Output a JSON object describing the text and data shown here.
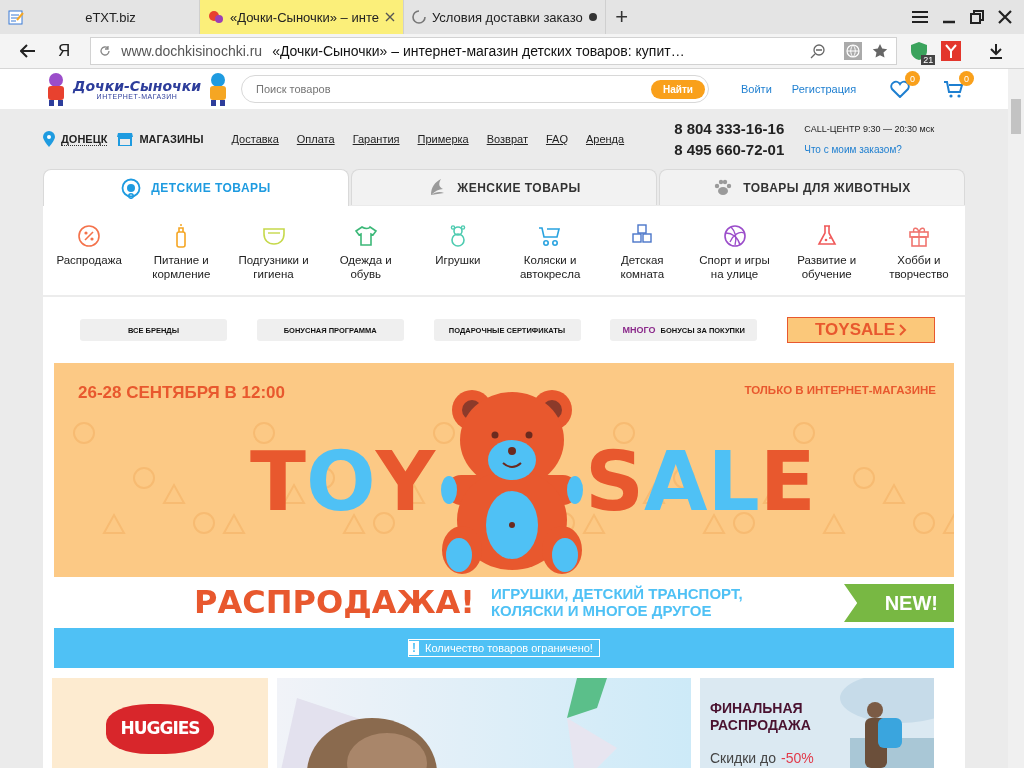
{
  "browser": {
    "tabs": [
      {
        "title": "eTXT.biz",
        "selected": false,
        "kind": "plain"
      },
      {
        "title": "«Дочки-Сыночки» – инте",
        "selected": true,
        "kind": "site"
      },
      {
        "title": "Условия доставки заказо",
        "selected": false,
        "kind": "loading"
      }
    ],
    "new_tab": "+",
    "search_engine": "Я",
    "domain": "www.dochkisinochki.ru",
    "page_title": "«Дочки-Сыночки» – интернет-магазин детских товаров: купит…",
    "protect_count": "21"
  },
  "header": {
    "logo": {
      "name": "Дочки-Сыночки",
      "tagline": "ИНТЕРНЕТ-МАГАЗИН"
    },
    "search": {
      "placeholder": "Поиск товаров",
      "button": "Найти"
    },
    "login": "Войти",
    "register": "Регистрация",
    "favorites_count": "0",
    "cart_count": "0"
  },
  "nav": {
    "city": "ДОНЕЦК",
    "stores": "МАГАЗИНЫ",
    "links": [
      "Доставка",
      "Оплата",
      "Гарантия",
      "Примерка",
      "Возврат",
      "FAQ",
      "Аренда"
    ],
    "phones": [
      "8 804 333-16-16",
      "8 495 660-72-01"
    ],
    "call_center": "CALL-ЦЕНТР 9:30 — 20:30 мск",
    "order_status": "Что с моим заказом?"
  },
  "category_tabs": [
    {
      "label": "ДЕТСКИЕ ТОВАРЫ",
      "selected": true
    },
    {
      "label": "ЖЕНСКИЕ ТОВАРЫ",
      "selected": false
    },
    {
      "label": "ТОВАРЫ ДЛЯ ЖИВОТНЫХ",
      "selected": false
    }
  ],
  "categories": [
    {
      "label": "Распродажа"
    },
    {
      "label": "Питание и кормление"
    },
    {
      "label": "Подгузники и гигиена"
    },
    {
      "label": "Одежда и обувь"
    },
    {
      "label": "Игрушки"
    },
    {
      "label": "Коляски и автокресла"
    },
    {
      "label": "Детская комната"
    },
    {
      "label": "Спорт и игры на улице"
    },
    {
      "label": "Развитие и обучение"
    },
    {
      "label": "Хобби и творчество"
    }
  ],
  "promo_links": [
    {
      "kind": "plain",
      "label": "ВСЕ БРЕНДЫ"
    },
    {
      "kind": "plain",
      "label": "БОНУСНАЯ ПРОГРАММА"
    },
    {
      "kind": "plain",
      "label": "ПОДАРОЧНЫЕ СЕРТИФИКАТЫ"
    },
    {
      "kind": "partner",
      "label": "БОНУСЫ ЗА ПОКУПКИ",
      "logo": "МНОГО"
    },
    {
      "kind": "banner",
      "label": "TOYSALE"
    }
  ],
  "banner": {
    "date": "26-28 СЕНТЯБРЯ В 12:00",
    "only_online": "ТОЛЬКО В ИНТЕРНЕТ-МАГАЗИНЕ",
    "letters": [
      {
        "letter": "T",
        "color": "#e8582e"
      },
      {
        "letter": "O",
        "color": "#4fc1f5"
      },
      {
        "letter": "Y",
        "color": "#e8582e"
      },
      {
        "letter": "S",
        "color": "#e8582e"
      },
      {
        "letter": "A",
        "color": "#4fc1f5"
      },
      {
        "letter": "L",
        "color": "#4fc1f5"
      },
      {
        "letter": "E",
        "color": "#e8582e"
      }
    ],
    "sale_title": "РАСПРОДАЖА!",
    "sale_lines": [
      "ИГРУШКИ, ДЕТСКИЙ ТРАНСПОРТ,",
      "КОЛЯСКИ И МНОГОЕ ДРУГОЕ"
    ],
    "new_badge": "NEW!",
    "notice_mark": "!",
    "notice": "Количество товаров ограничено!"
  },
  "tiles": [
    {
      "kind": "brand",
      "logo": "HUGGIES"
    },
    {
      "kind": "picture"
    },
    {
      "kind": "promo",
      "title": "ФИНАЛЬНАЯ РАСПРОДАЖА",
      "discount_label": "Скидки до",
      "discount": "-50%"
    }
  ]
}
